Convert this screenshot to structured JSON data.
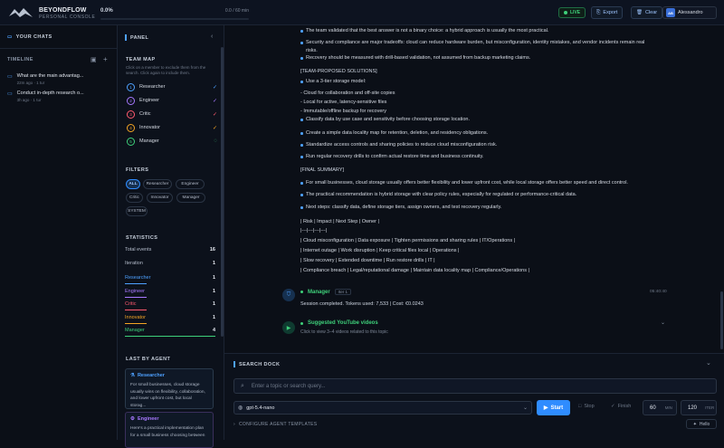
{
  "brand": {
    "title": "BEYONDFLOW",
    "subtitle": "PERSONAL CONSOLE"
  },
  "progress": {
    "percent_label": "0.0%",
    "time_label": "0.0 / 60 min",
    "fraction": 0.0
  },
  "header": {
    "live": "LIVE",
    "export": "Export",
    "clear": "Clear",
    "user_initials": "AB",
    "user_name": "Alessandro"
  },
  "sidebar": {
    "your_chats": "YOUR CHATS",
    "timeline": "TIMELINE",
    "chats": [
      {
        "title": "What are the main advantag...",
        "meta": "22m ago · 1 tur"
      },
      {
        "title": "Conduct in-depth research o...",
        "meta": "3h ago · 1 tur"
      }
    ]
  },
  "panel": {
    "title": "PANEL",
    "team_map_title": "TEAM MAP",
    "team_map_hint": "Click on a member to exclude them from the search. Click again to include them.",
    "members": [
      {
        "n": "1",
        "name": "Researcher",
        "color": "#4ea1ff",
        "status": "✓"
      },
      {
        "n": "2",
        "name": "Engineer",
        "color": "#a778ff",
        "status": "✓"
      },
      {
        "n": "3",
        "name": "Critic",
        "color": "#ff5a6e",
        "status": "✓"
      },
      {
        "n": "4",
        "name": "Innovator",
        "color": "#f5a524",
        "status": "✓"
      },
      {
        "n": "5",
        "name": "Manager",
        "color": "#3ed07a",
        "status": "◌"
      }
    ],
    "filters_title": "FILTERS",
    "filters": [
      "ALL",
      "Researcher",
      "Engineer",
      "Critic",
      "Innovator",
      "Manager",
      "SYSTEM"
    ],
    "statistics_title": "STATISTICS",
    "stats": [
      {
        "label": "Total events",
        "value": "16"
      },
      {
        "label": "Iteration",
        "value": "1"
      },
      {
        "label": "Researcher",
        "value": "1"
      },
      {
        "label": "Engineer",
        "value": "1"
      },
      {
        "label": "Critic",
        "value": "1"
      },
      {
        "label": "Innovator",
        "value": "1"
      },
      {
        "label": "Manager",
        "value": "4"
      }
    ],
    "last_by_agent_title": "LAST BY AGENT",
    "last": [
      {
        "name": "Researcher",
        "text": "For small businesses, cloud storage usually wins on flexibility, collaboration, and lower upfront cost, but local storag..."
      },
      {
        "name": "Engineer",
        "text": "Here's a practical implementation plan for a small business choosing between"
      }
    ]
  },
  "content": {
    "lines": [
      "The team validated that the best answer is not a binary choice: a hybrid approach is usually the most practical.",
      "Security and compliance are major tradeoffs: cloud can reduce hardware burden, but misconfiguration, identity mistakes, and vendor incidents remain real",
      "risks.",
      "Recovery should be measured with drill-based validation, not assumed from backup marketing claims.",
      "[TEAM-PROPOSED SOLUTIONS]",
      "Use a 3-tier storage model:",
      "- Cloud for collaboration and off-site copies",
      "- Local for active, latency-sensitive files",
      "- Immutable/offline backup for recovery",
      "Classify data by use case and sensitivity before choosing storage location.",
      "Create a simple data locality map for retention, deletion, and residency obligations.",
      "Standardize access controls and sharing policies to reduce cloud misconfiguration risk.",
      "Run regular recovery drills to confirm actual restore time and business continuity.",
      "[FINAL SUMMARY]",
      "For small businesses, cloud storage usually offers better flexibility and lower upfront cost, while local storage offers better speed and direct control.",
      "The practical recommendation is hybrid storage with clear policy rules, especially for regulated or performance-critical data.",
      "Next steps: classify data, define storage tiers, assign owners, and test recovery regularly.",
      "| Risk | Impact | Next Step | Owner |",
      "|---|---|---|---|",
      "| Cloud misconfiguration | Data exposure | Tighten permissions and sharing rules | IT/Operations |",
      "| Internet outage | Work disruption | Keep critical files local | Operations |",
      "| Slow recovery | Extended downtime | Run restore drills | IT |",
      "| Compliance breach | Legal/reputational damage | Maintain data locality map | Compliance/Operations |"
    ],
    "manager_name": "Manager",
    "manager_badge": "Iter 1",
    "manager_time": "05:40:40",
    "manager_text": "Session completed. Tokens used: 7,533 | Cost: €0.0243",
    "yt_title": "Suggested YouTube videos",
    "yt_text": "Click to view 3–4 videos related to this topic"
  },
  "dock": {
    "title": "SEARCH DOCK",
    "placeholder": "Enter a topic or search query...",
    "model": "gpt-5.4-nano",
    "start": "Start",
    "stop": "Stop",
    "finish": "Finish",
    "min_value": "60",
    "min_unit": "MIN",
    "iter_value": "120",
    "iter_unit": "ITER",
    "configure": "CONFIGURE AGENT TEMPLATES",
    "hello": "Hello"
  }
}
